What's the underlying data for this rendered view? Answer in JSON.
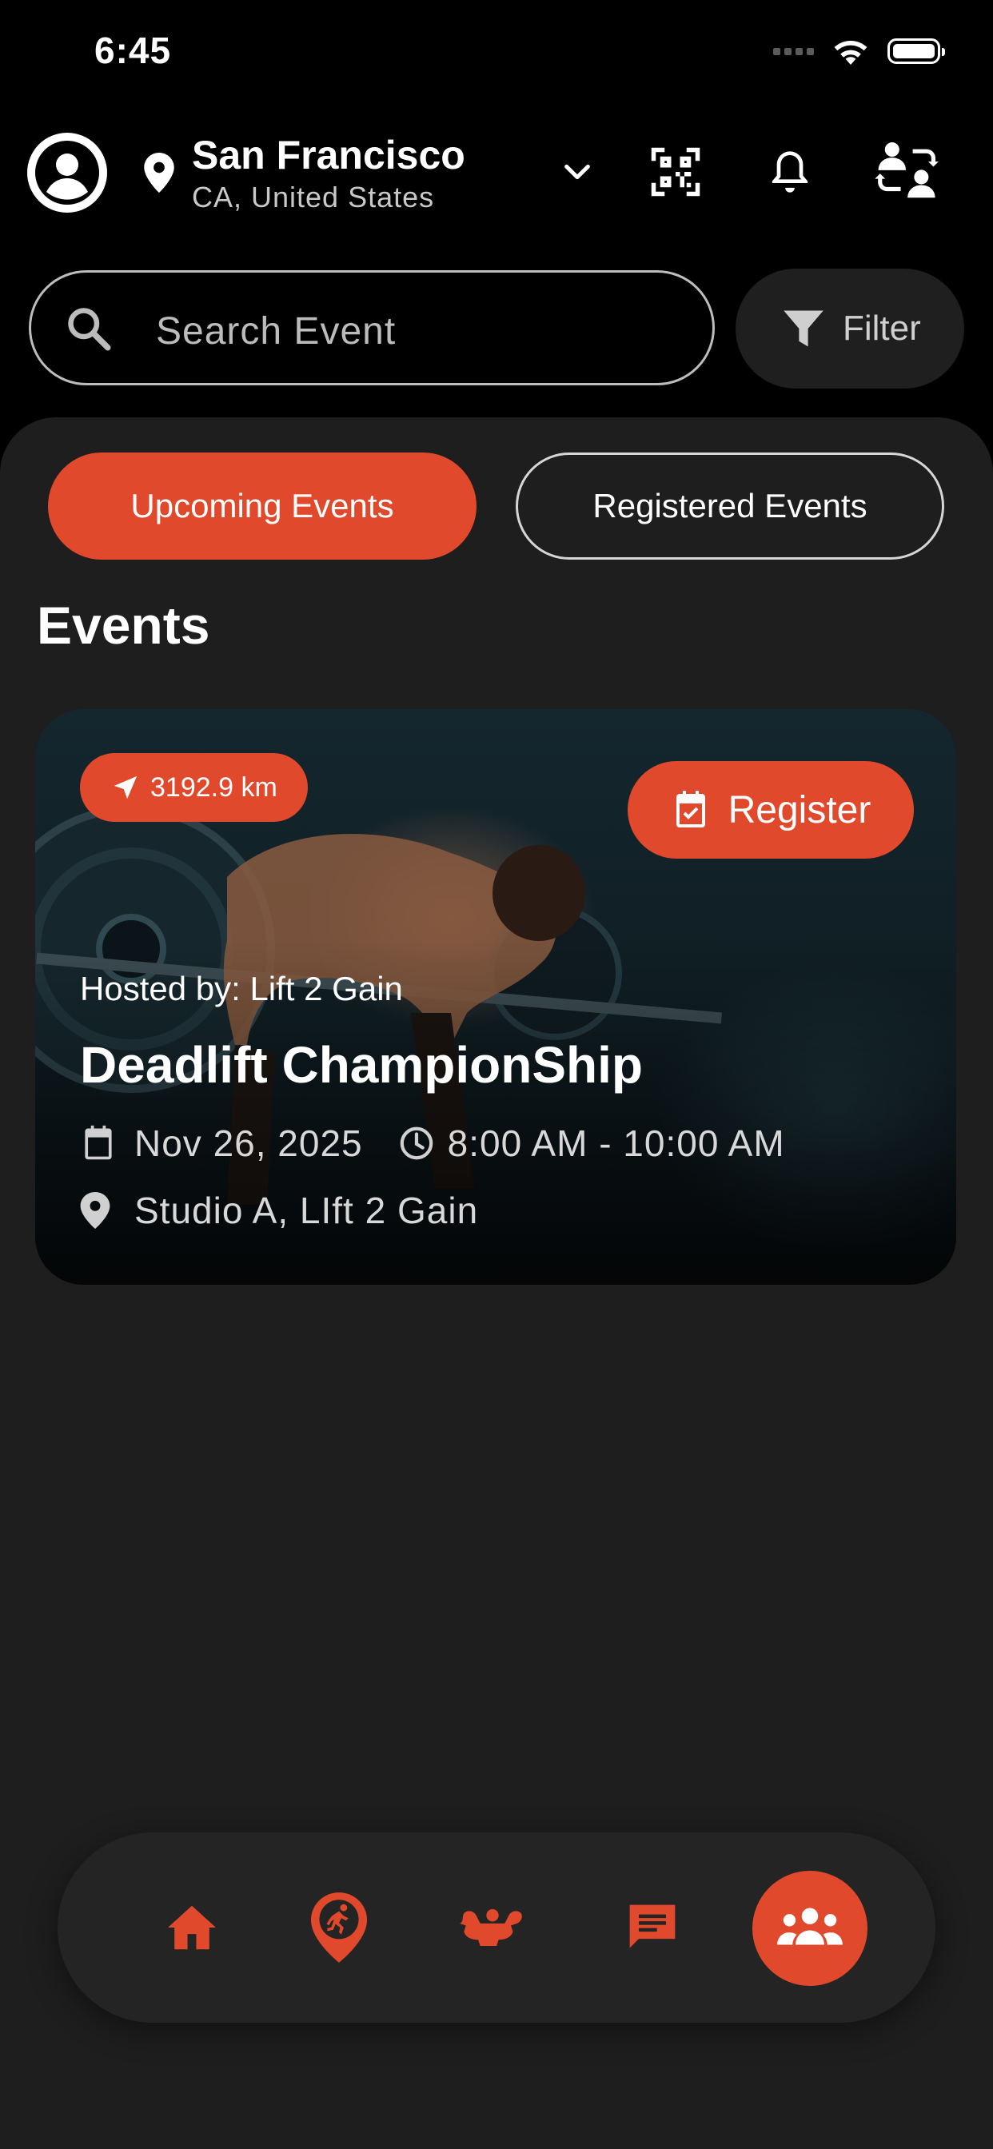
{
  "status_bar": {
    "time": "6:45"
  },
  "header": {
    "city": "San Francisco",
    "region": "CA, United States"
  },
  "search": {
    "placeholder": "Search Event",
    "filter_label": "Filter"
  },
  "tabs": [
    {
      "label": "Upcoming Events",
      "active": true
    },
    {
      "label": "Registered Events",
      "active": false
    }
  ],
  "section_title": "Events",
  "events": [
    {
      "distance": "3192.9 km",
      "register_label": "Register",
      "hosted_by": "Hosted by: Lift 2 Gain",
      "name": "Deadlift ChampionShip",
      "date": "Nov 26, 2025",
      "time": "8:00 AM - 10:00 AM",
      "location": "Studio A, LIft 2 Gain"
    }
  ],
  "bottom_nav": [
    {
      "icon": "home-icon"
    },
    {
      "icon": "running-location-icon"
    },
    {
      "icon": "muscle-icon"
    },
    {
      "icon": "chat-icon"
    },
    {
      "icon": "group-icon",
      "active": true
    }
  ],
  "colors": {
    "accent": "#e0492c",
    "background": "#000000",
    "panel": "#1e1e1e"
  }
}
